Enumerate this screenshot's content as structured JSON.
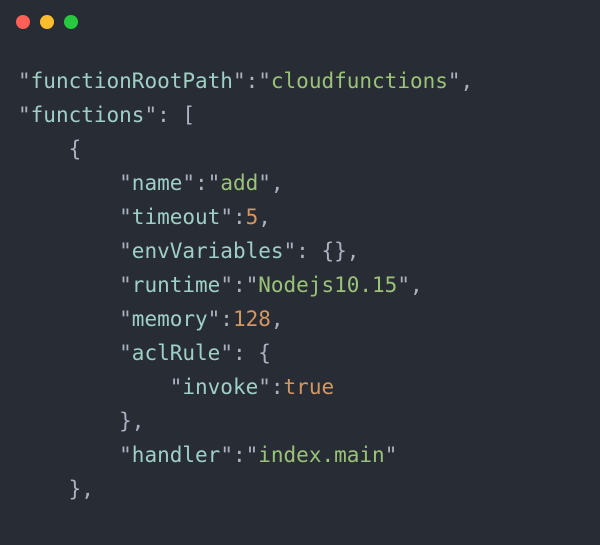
{
  "window": {
    "dot_close_color": "#ff5f56",
    "dot_min_color": "#ffbd2e",
    "dot_max_color": "#27c93f"
  },
  "json": {
    "key_functionRootPath": "functionRootPath",
    "val_functionRootPath": "cloudfunctions",
    "key_functions": "functions",
    "key_name": "name",
    "val_name": "add",
    "key_timeout": "timeout",
    "val_timeout": "5",
    "key_envVariables": "envVariables",
    "key_runtime": "runtime",
    "val_runtime": "Nodejs10.15",
    "key_memory": "memory",
    "val_memory": "128",
    "key_aclRule": "aclRule",
    "key_invoke": "invoke",
    "val_invoke": "true",
    "key_handler": "handler",
    "val_handler": "index.main"
  }
}
